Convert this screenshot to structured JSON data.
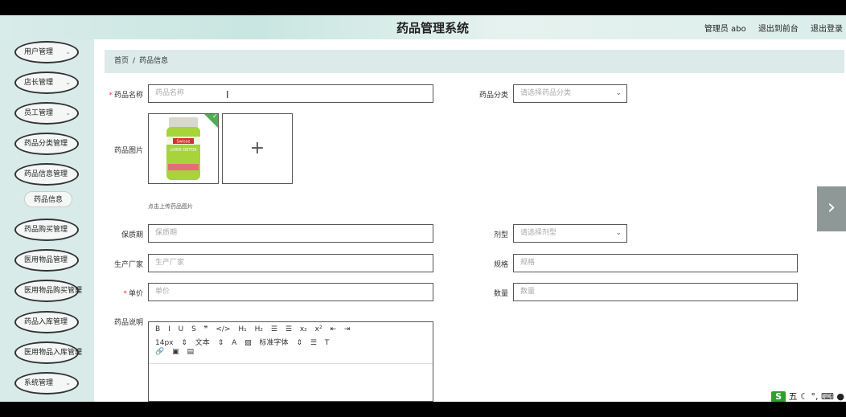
{
  "header": {
    "title": "药品管理系统",
    "user": "管理员 abo",
    "back_link": "退出到前台",
    "logout_link": "退出登录"
  },
  "sidebar": {
    "items": [
      {
        "label": "用户管理",
        "has_chevron": true
      },
      {
        "label": "店长管理",
        "has_chevron": true
      },
      {
        "label": "员工管理",
        "has_chevron": true
      },
      {
        "label": "药品分类管理",
        "has_chevron": false
      },
      {
        "label": "药品信息管理",
        "has_chevron": false
      },
      {
        "label": "药品购买管理",
        "has_chevron": false
      },
      {
        "label": "医用物品管理",
        "has_chevron": false
      },
      {
        "label": "医用物品购买管理",
        "has_chevron": false
      },
      {
        "label": "药品入库管理",
        "has_chevron": false
      },
      {
        "label": "医用物品入库管理",
        "has_chevron": false
      },
      {
        "label": "系统管理",
        "has_chevron": true
      }
    ],
    "sub_item": "药品信息",
    "chevron_glyph": "⌄"
  },
  "breadcrumb": {
    "home": "首页",
    "sep": "/",
    "current": "药品信息"
  },
  "form": {
    "name_label": "药品名称",
    "name_placeholder": "药品名称",
    "category_label": "药品分类",
    "category_placeholder": "请选择药品分类",
    "image_label": "药品图片",
    "upload_hint": "点击上传药品图片",
    "upload_plus": "+",
    "product": {
      "brand": "Swisse",
      "name": "LIVER DETOX"
    },
    "shelf_label": "保质期",
    "shelf_placeholder": "保质期",
    "dosage_label": "剂型",
    "dosage_placeholder": "请选择剂型",
    "maker_label": "生产厂家",
    "maker_placeholder": "生产厂家",
    "spec_label": "规格",
    "spec_placeholder": "规格",
    "price_label": "单价",
    "price_placeholder": "单价",
    "qty_label": "数量",
    "qty_placeholder": "数量",
    "desc_label": "药品说明",
    "required_mark": "*"
  },
  "editor": {
    "row1": [
      "B",
      "I",
      "U",
      "S",
      "❞",
      "</>",
      "H₁",
      "H₂",
      "☰",
      "☰",
      "x₂",
      "x²",
      "⇤",
      "⇥"
    ],
    "size": "14px",
    "format": "文本",
    "font": "标准字体",
    "row3": [
      "🔗",
      "▣",
      "▤"
    ]
  },
  "tray": {
    "ime": "五"
  },
  "colors": {
    "sidebar_bg": "#d8ebe9",
    "breadcrumb_bg": "#dcebea",
    "required": "#e33333",
    "check_green": "#4caf50"
  }
}
